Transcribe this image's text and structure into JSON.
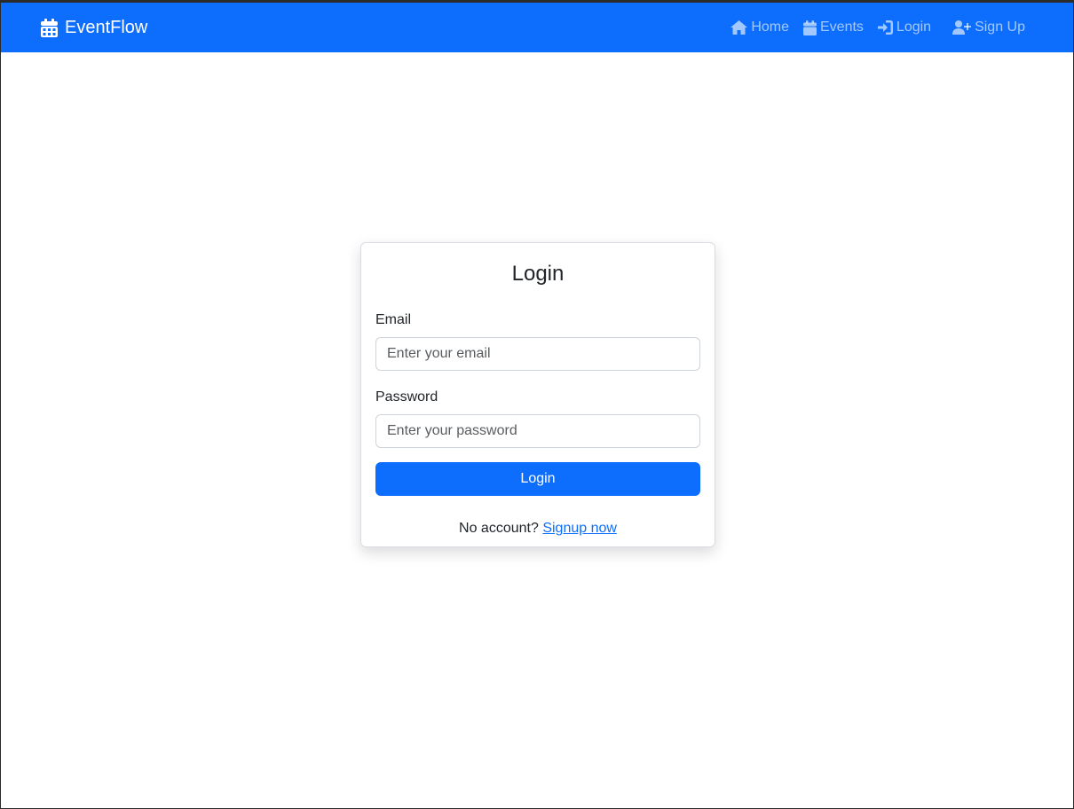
{
  "navbar": {
    "brand": "EventFlow",
    "brand_icon": "calendar-icon",
    "links": [
      {
        "label": "Home",
        "icon": "home-icon"
      },
      {
        "label": "Events",
        "icon": "calendar-icon"
      },
      {
        "label": "Login",
        "icon": "sign-in-icon"
      },
      {
        "label": "Sign Up",
        "icon": "user-plus-icon"
      }
    ]
  },
  "login_card": {
    "title": "Login",
    "email_label": "Email",
    "email_placeholder": "Enter your email",
    "password_label": "Password",
    "password_placeholder": "Enter your password",
    "submit_label": "Login",
    "signup_prompt": "No account?",
    "signup_link": "Signup now"
  },
  "colors": {
    "primary": "#0d6efd",
    "text": "#212529",
    "border": "#ced4da"
  }
}
